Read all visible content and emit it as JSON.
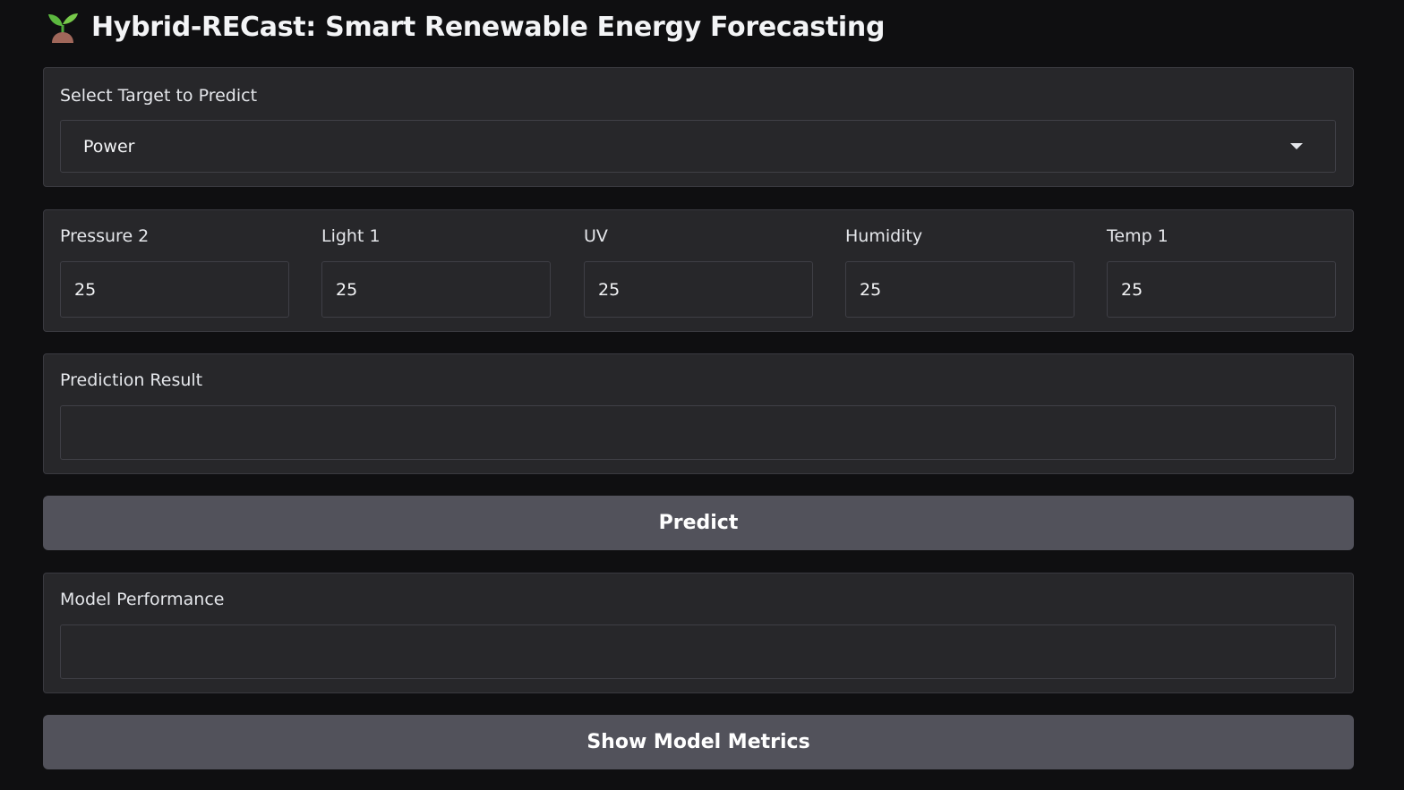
{
  "app": {
    "title": "Hybrid-RECast: Smart Renewable Energy Forecasting",
    "title_icon": "seedling-icon"
  },
  "target_select": {
    "label": "Select Target to Predict",
    "selected_value": "Power",
    "icon": "chevron-down-icon"
  },
  "inputs": [
    {
      "label": "Pressure 2",
      "value": "25"
    },
    {
      "label": "Light 1",
      "value": "25"
    },
    {
      "label": "UV",
      "value": "25"
    },
    {
      "label": "Humidity",
      "value": "25"
    },
    {
      "label": "Temp 1",
      "value": "25"
    }
  ],
  "prediction": {
    "label": "Prediction Result",
    "value": ""
  },
  "predict_button": {
    "label": "Predict"
  },
  "performance": {
    "label": "Model Performance",
    "value": ""
  },
  "metrics_button": {
    "label": "Show Model Metrics"
  },
  "colors": {
    "background": "#0f0f11",
    "block": "#27272a",
    "border": "#3f3f46",
    "button": "#52525b",
    "text": "#f3f4f6"
  }
}
